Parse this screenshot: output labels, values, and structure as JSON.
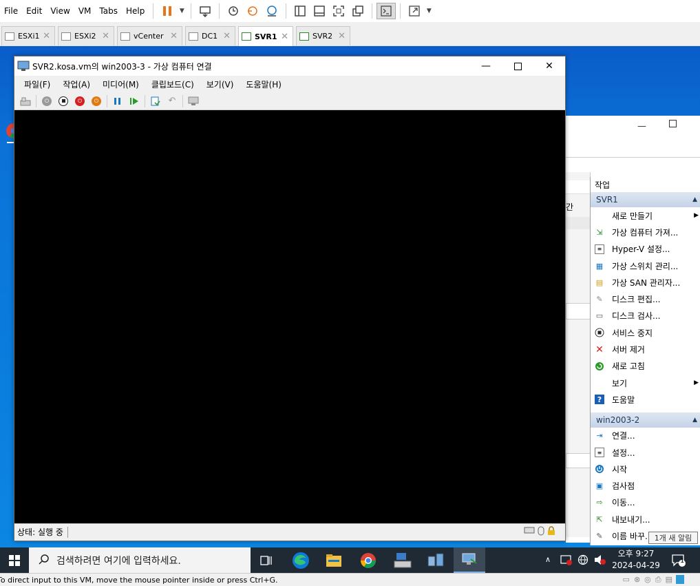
{
  "vmware": {
    "menu": [
      "File",
      "Edit",
      "View",
      "VM",
      "Tabs",
      "Help"
    ],
    "tabs": [
      {
        "label": "ESXi1",
        "active": false
      },
      {
        "label": "ESXi2",
        "active": false
      },
      {
        "label": "vCenter",
        "active": false
      },
      {
        "label": "DC1",
        "active": false
      },
      {
        "label": "SVR1",
        "active": true
      },
      {
        "label": "SVR2",
        "active": false
      }
    ],
    "status_text": "To direct input to this VM, move the mouse pointer inside or press Ctrl+G."
  },
  "vmconnect": {
    "title": "SVR2.kosa.vm의 win2003-3 - 가상 컴퓨터 연결",
    "menu": [
      "파일(F)",
      "작업(A)",
      "미디어(M)",
      "클립보드(C)",
      "보기(V)",
      "도움말(H)"
    ],
    "status": "상태: 실행 중"
  },
  "actions": {
    "header": "작업",
    "section1": "SVR1",
    "items1": [
      "새로 만들기",
      "가상 컴퓨터 가져...",
      "Hyper-V 설정...",
      "가상 스위치 관리...",
      "가상 SAN 관리자...",
      "디스크 편집...",
      "디스크 검사...",
      "서비스 중지",
      "서버 제거",
      "새로 고침",
      "보기",
      "도움말"
    ],
    "section2": "win2003-2",
    "items2": [
      "연결...",
      "설정...",
      "시작",
      "검사점",
      "이동...",
      "내보내기...",
      "이름 바꾸..."
    ],
    "partial_text": "간"
  },
  "taskbar": {
    "search_placeholder": "검색하려면 여기에 입력하세요.",
    "time": "오후 9:27",
    "date": "2024-04-29",
    "notification_tooltip": "1개 새 알림",
    "notification_count": "1"
  },
  "colors": {
    "desktop": "#0b78dc",
    "taskbar": "#1f2a35",
    "vmware_pause": "#e8731a"
  }
}
